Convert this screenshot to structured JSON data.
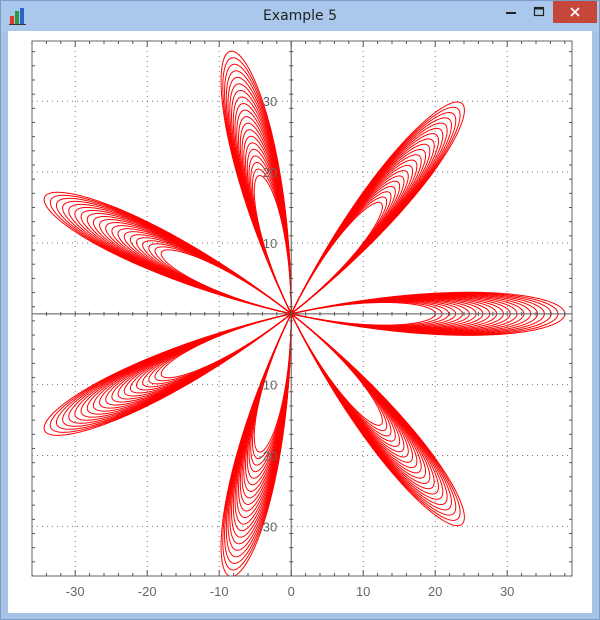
{
  "window": {
    "title": "Example 5"
  },
  "controls": {
    "minimize": "minimize",
    "maximize": "maximize",
    "close": "close"
  },
  "chart_data": {
    "type": "line",
    "title": "",
    "xlabel": "",
    "ylabel": "",
    "xlim": [
      -36,
      39
    ],
    "ylim": [
      -37,
      38.5
    ],
    "xticks": [
      -30,
      -20,
      -10,
      0,
      10,
      20,
      30
    ],
    "yticks": [
      -30,
      -20,
      -10,
      10,
      20,
      30
    ],
    "x_tick_labels": [
      "-30",
      "-20",
      "-10",
      "0",
      "10",
      "20",
      "30"
    ],
    "y_tick_labels": [
      "-30",
      "-20",
      "-10",
      "10",
      "20",
      "30"
    ],
    "grid": true,
    "series": [
      {
        "curve": "rose",
        "petals": 7,
        "petal_reach_range": [
          20,
          38
        ],
        "curve_count": 20,
        "color": "#ff0000"
      }
    ]
  }
}
